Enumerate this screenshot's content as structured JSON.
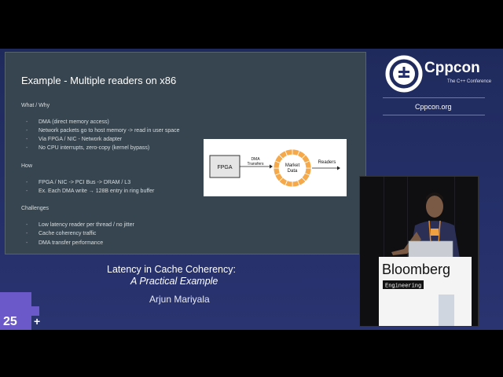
{
  "slide": {
    "title": "Example - Multiple readers on x86",
    "sections": [
      {
        "heading": "What / Why",
        "items": [
          "DMA (direct memory access)",
          "Network packets go to host memory -> read in user space",
          "Via FPGA / NIC - Network adapter",
          "No CPU interrupts, zero-copy (kernel bypass)"
        ]
      },
      {
        "heading": "How",
        "items": [
          "FPGA / NIC -> PCI Bus -> DRAM / L3",
          "Ex. Each DMA write → 128B entry in ring buffer"
        ]
      },
      {
        "heading": "Challenges",
        "items": [
          "Low latency reader per thread / no jitter",
          "Cache coherency traffic",
          "DMA transfer performance"
        ]
      }
    ],
    "bullet_dash": "-",
    "diagram": {
      "fpga": "FPGA",
      "dma_line1": "DMA",
      "dma_line2": "Transfers",
      "market_line1": "Market",
      "market_line2": "Data",
      "readers": "Readers"
    }
  },
  "branding": {
    "name": "Cppcon",
    "tagline": "The C++ Conference",
    "url": "Cppcon.org",
    "anniversary": "25",
    "anniversary_plus": "+"
  },
  "talk": {
    "title": "Latency in Cache Coherency:",
    "subtitle": "A Practical Example",
    "speaker": "Arjun Mariyala"
  },
  "sponsor": {
    "name": "Bloomberg",
    "division": "Engineering"
  },
  "colors": {
    "accent_purple": "#6b58c9",
    "ring_orange": "#f5a94a",
    "background": "#25306a"
  }
}
